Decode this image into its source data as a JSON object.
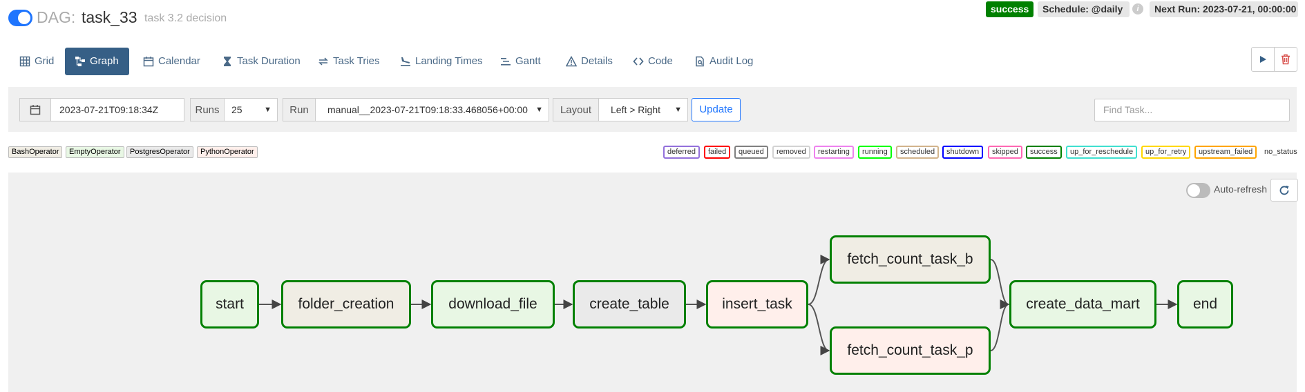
{
  "header": {
    "dag_prefix": "DAG:",
    "dag_id": "task_33",
    "description": "task 3.2 decision",
    "status_badge": "success",
    "schedule": "Schedule: @daily",
    "info_icon": "i",
    "next_run": "Next Run: 2023-07-21, 00:00:00"
  },
  "nav": {
    "tabs": [
      {
        "label": "Grid",
        "icon": "grid-icon"
      },
      {
        "label": "Graph",
        "icon": "graph-icon"
      },
      {
        "label": "Calendar",
        "icon": "calendar-icon"
      },
      {
        "label": "Task Duration",
        "icon": "hourglass-icon"
      },
      {
        "label": "Task Tries",
        "icon": "retry-icon"
      },
      {
        "label": "Landing Times",
        "icon": "landing-icon"
      },
      {
        "label": "Gantt",
        "icon": "gantt-icon"
      },
      {
        "label": "Details",
        "icon": "warning-triangle-icon"
      },
      {
        "label": "Code",
        "icon": "code-icon"
      },
      {
        "label": "Audit Log",
        "icon": "audit-icon"
      }
    ],
    "active_tab": "Graph",
    "actions": [
      "play-icon",
      "trash-icon"
    ]
  },
  "toolbar": {
    "base_date": "2023-07-21T09:18:34Z",
    "runs_label": "Runs",
    "runs_value": "25",
    "run_label": "Run",
    "run_value": "manual__2023-07-21T09:18:33.468056+00:00",
    "layout_label": "Layout",
    "layout_value": "Left > Right",
    "update_label": "Update",
    "find_task_placeholder": "Find Task..."
  },
  "operators": [
    {
      "name": "BashOperator",
      "color": "#f0ede4"
    },
    {
      "name": "EmptyOperator",
      "color": "#e8f7e4"
    },
    {
      "name": "PostgresOperator",
      "color": "#eaeaea"
    },
    {
      "name": "PythonOperator",
      "color": "#ffefeb"
    }
  ],
  "states": [
    {
      "name": "deferred",
      "color": "#9370db"
    },
    {
      "name": "failed",
      "color": "#ff0000"
    },
    {
      "name": "queued",
      "color": "#808080"
    },
    {
      "name": "removed",
      "color": "#d3d3d3"
    },
    {
      "name": "restarting",
      "color": "#ee82ee"
    },
    {
      "name": "running",
      "color": "#00ff00"
    },
    {
      "name": "scheduled",
      "color": "#d2b48c"
    },
    {
      "name": "shutdown",
      "color": "#0000ff"
    },
    {
      "name": "skipped",
      "color": "#ff69b4"
    },
    {
      "name": "success",
      "color": "#008000"
    },
    {
      "name": "up_for_reschedule",
      "color": "#40e0d0"
    },
    {
      "name": "up_for_retry",
      "color": "#ffd700"
    },
    {
      "name": "upstream_failed",
      "color": "#ffa500"
    },
    {
      "name": "no_status",
      "color": "#ffffff"
    }
  ],
  "graph": {
    "auto_refresh_label": "Auto-refresh",
    "auto_refresh_on": false,
    "nodes": [
      {
        "id": "start",
        "label": "start",
        "operator": "EmptyOperator",
        "state": "success"
      },
      {
        "id": "folder_creation",
        "label": "folder_creation",
        "operator": "BashOperator",
        "state": "success"
      },
      {
        "id": "download_file",
        "label": "download_file",
        "operator": "EmptyOperator",
        "state": "success"
      },
      {
        "id": "create_table",
        "label": "create_table",
        "operator": "PostgresOperator",
        "state": "success"
      },
      {
        "id": "insert_task",
        "label": "insert_task",
        "operator": "PythonOperator",
        "state": "success"
      },
      {
        "id": "fetch_count_task_b",
        "label": "fetch_count_task_b",
        "operator": "BashOperator",
        "state": "success"
      },
      {
        "id": "fetch_count_task_p",
        "label": "fetch_count_task_p",
        "operator": "PythonOperator",
        "state": "success"
      },
      {
        "id": "create_data_mart",
        "label": "create_data_mart",
        "operator": "EmptyOperator",
        "state": "success"
      },
      {
        "id": "end",
        "label": "end",
        "operator": "EmptyOperator",
        "state": "success"
      }
    ],
    "edges": [
      [
        "start",
        "folder_creation"
      ],
      [
        "folder_creation",
        "download_file"
      ],
      [
        "download_file",
        "create_table"
      ],
      [
        "create_table",
        "insert_task"
      ],
      [
        "insert_task",
        "fetch_count_task_b"
      ],
      [
        "insert_task",
        "fetch_count_task_p"
      ],
      [
        "fetch_count_task_b",
        "create_data_mart"
      ],
      [
        "fetch_count_task_p",
        "create_data_mart"
      ],
      [
        "create_data_mart",
        "end"
      ]
    ]
  }
}
